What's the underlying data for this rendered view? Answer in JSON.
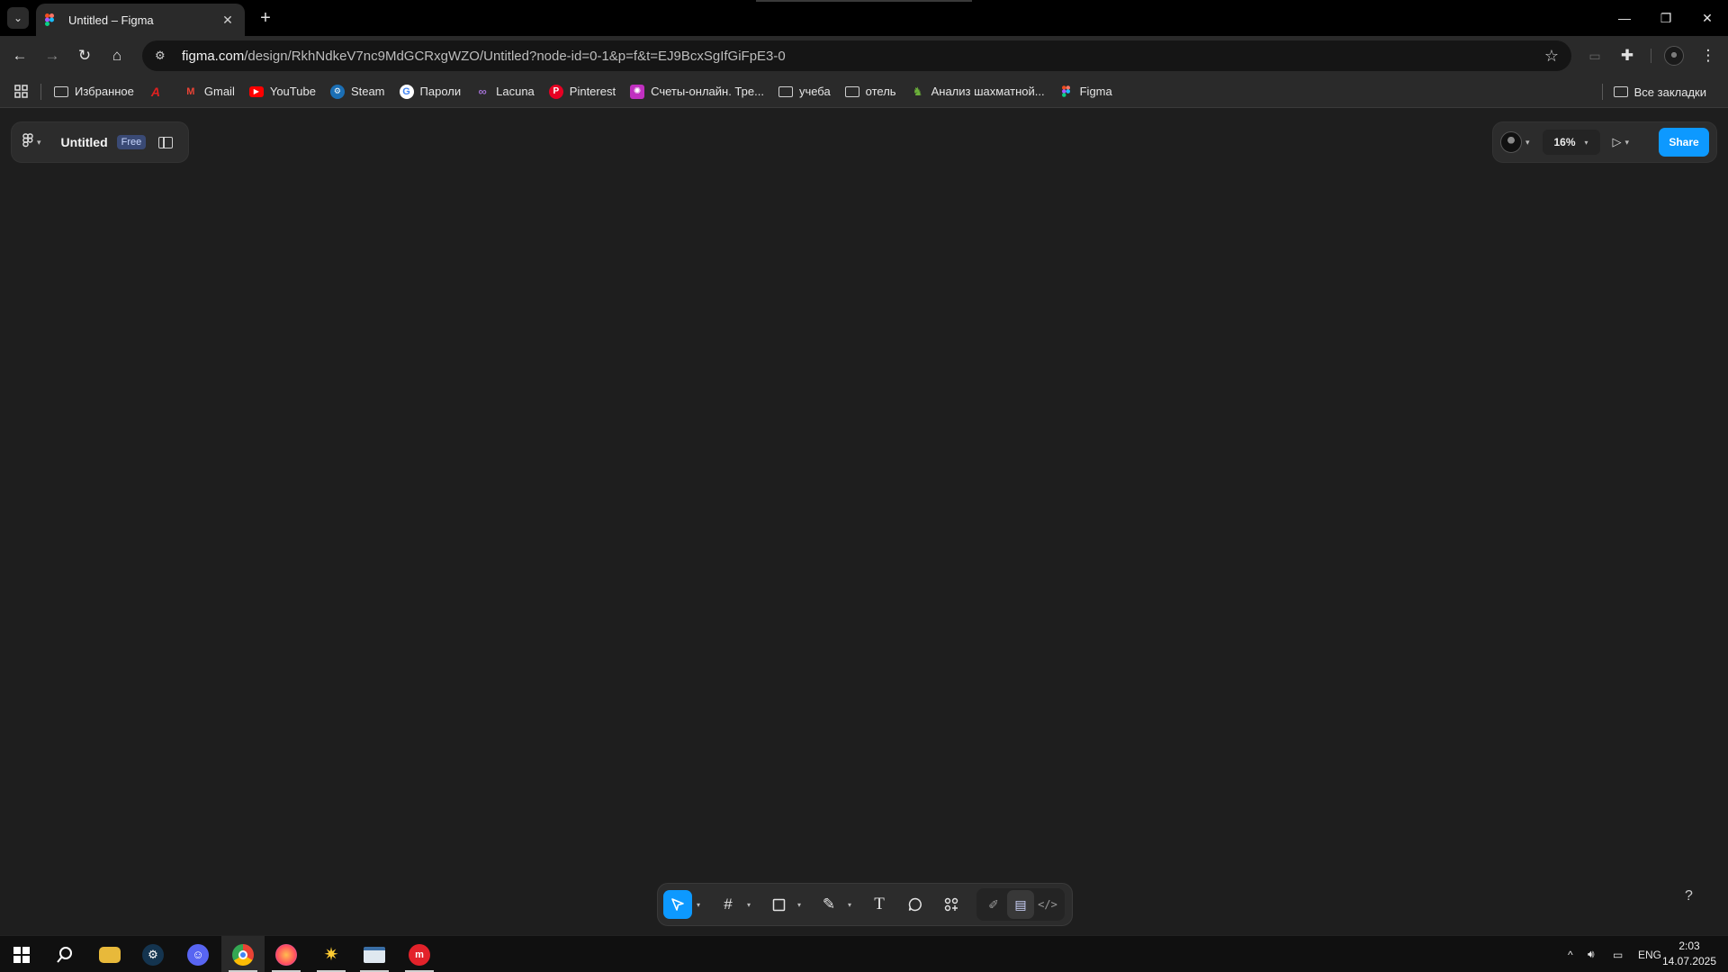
{
  "browser": {
    "tab_title": "Untitled – Figma",
    "url_host": "figma.com",
    "url_path": "/design/RkhNdkeV7nc9MdGCRxgWZO/Untitled?node-id=0-1&p=f&t=EJ9BcxSgIfGiFpE3-0"
  },
  "bookmarks": [
    {
      "label": "Избранное",
      "icon": "folder-icon"
    },
    {
      "label": "",
      "icon": "acrobat-icon",
      "color": "#e02020"
    },
    {
      "label": "Gmail",
      "icon": "gmail-icon",
      "color": "#ea4335"
    },
    {
      "label": "YouTube",
      "icon": "youtube-icon",
      "color": "#ff0000"
    },
    {
      "label": "Steam",
      "icon": "steam-icon",
      "color": "#1b6fb5"
    },
    {
      "label": "Пароли",
      "icon": "google-icon",
      "color": "#4285f4"
    },
    {
      "label": "Lacuna",
      "icon": "lacuna-icon",
      "color": "#a070d0"
    },
    {
      "label": "Pinterest",
      "icon": "pinterest-icon",
      "color": "#e60023"
    },
    {
      "label": "Счеты-онлайн. Тре...",
      "icon": "abacus-icon",
      "color": "#c030c0"
    },
    {
      "label": "учеба",
      "icon": "folder-icon"
    },
    {
      "label": "отель",
      "icon": "folder-icon"
    },
    {
      "label": "Анализ шахматной...",
      "icon": "chess-icon",
      "color": "#6bb03a"
    },
    {
      "label": "Figma",
      "icon": "figma-icon",
      "color": "#f24e1e"
    }
  ],
  "all_bookmarks": "Все закладки",
  "figma": {
    "file_title": "Untitled",
    "plan_badge": "Free",
    "zoom": "16%",
    "share_label": "Share",
    "help": "?"
  },
  "colors": {
    "accent": "#0d99ff",
    "canvas": "#1e1e1e",
    "panel": "#2c2c2c"
  },
  "tray": {
    "language": "ENG",
    "time": "2:03",
    "date": "14.07.2025"
  }
}
